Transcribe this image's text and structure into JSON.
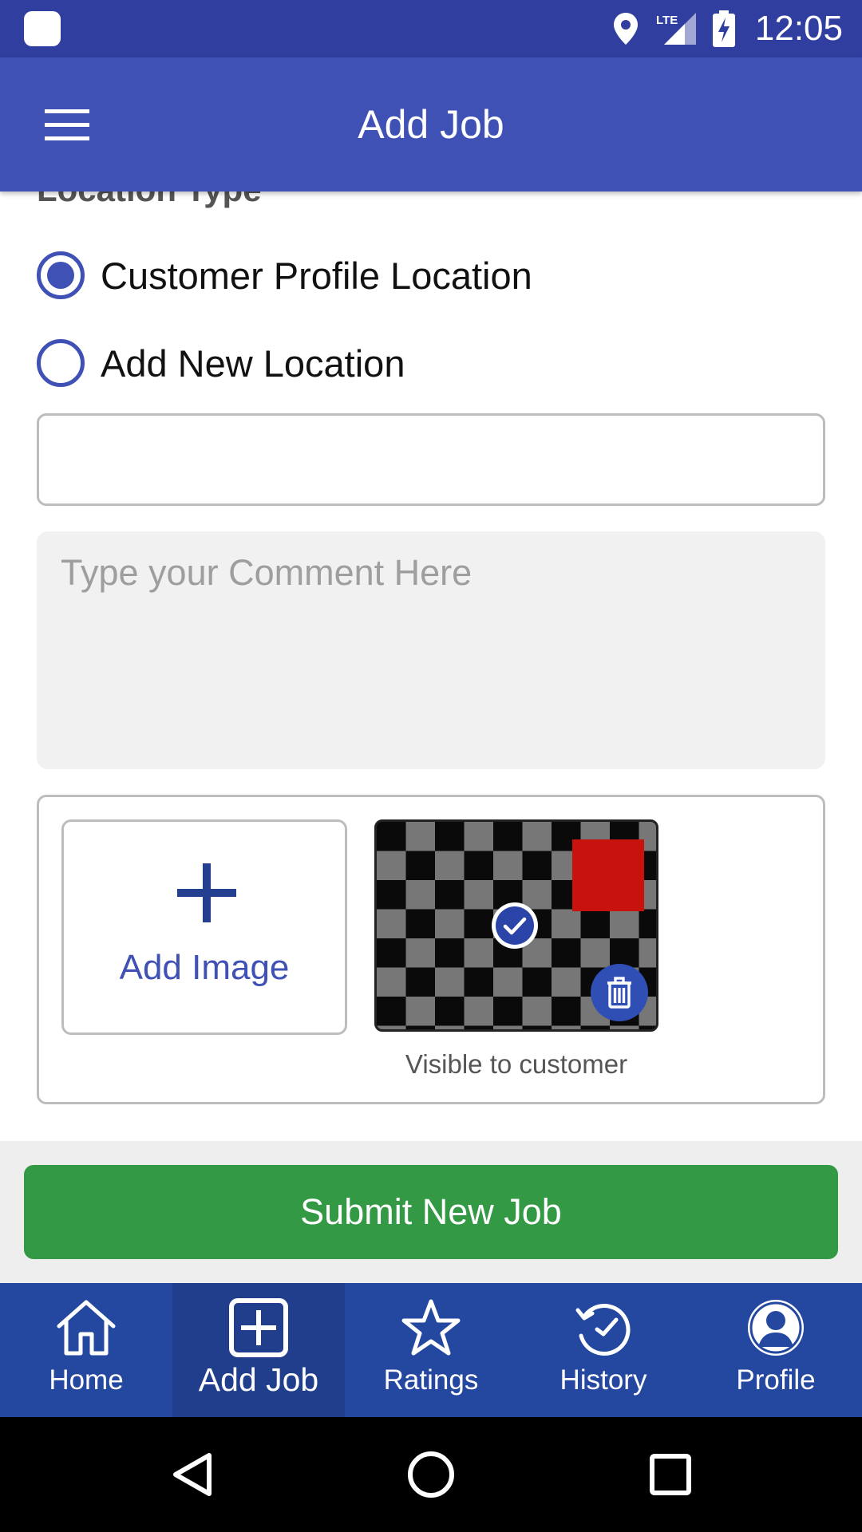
{
  "status_bar": {
    "time": "12:05",
    "network": "LTE"
  },
  "app_bar": {
    "title": "Add Job",
    "menu_icon": "hamburger-menu-icon"
  },
  "form": {
    "location_type_label": "Location Type",
    "location_options": [
      {
        "label": "Customer Profile Location",
        "selected": true
      },
      {
        "label": "Add New Location",
        "selected": false
      }
    ],
    "location_input": {
      "value": "",
      "placeholder": ""
    },
    "comment": {
      "value": "",
      "placeholder": "Type your Comment Here"
    },
    "images": {
      "add_image_label": "Add Image",
      "thumbnail_caption": "Visible to customer",
      "thumbnail_selected": true
    }
  },
  "submit": {
    "label": "Submit New Job",
    "color": "#339944"
  },
  "bottom_nav": {
    "items": [
      {
        "label": "Home",
        "icon": "home-icon",
        "active": false
      },
      {
        "label": "Add Job",
        "icon": "add-square-icon",
        "active": true
      },
      {
        "label": "Ratings",
        "icon": "star-icon",
        "active": false
      },
      {
        "label": "History",
        "icon": "history-icon",
        "active": false
      },
      {
        "label": "Profile",
        "icon": "profile-icon",
        "active": false
      }
    ]
  },
  "colors": {
    "status_bar": "#303f9f",
    "app_bar": "#3f51b5",
    "accent": "#3f51b5",
    "bottom_nav": "#2447a0",
    "bottom_nav_active": "#203e8c"
  }
}
